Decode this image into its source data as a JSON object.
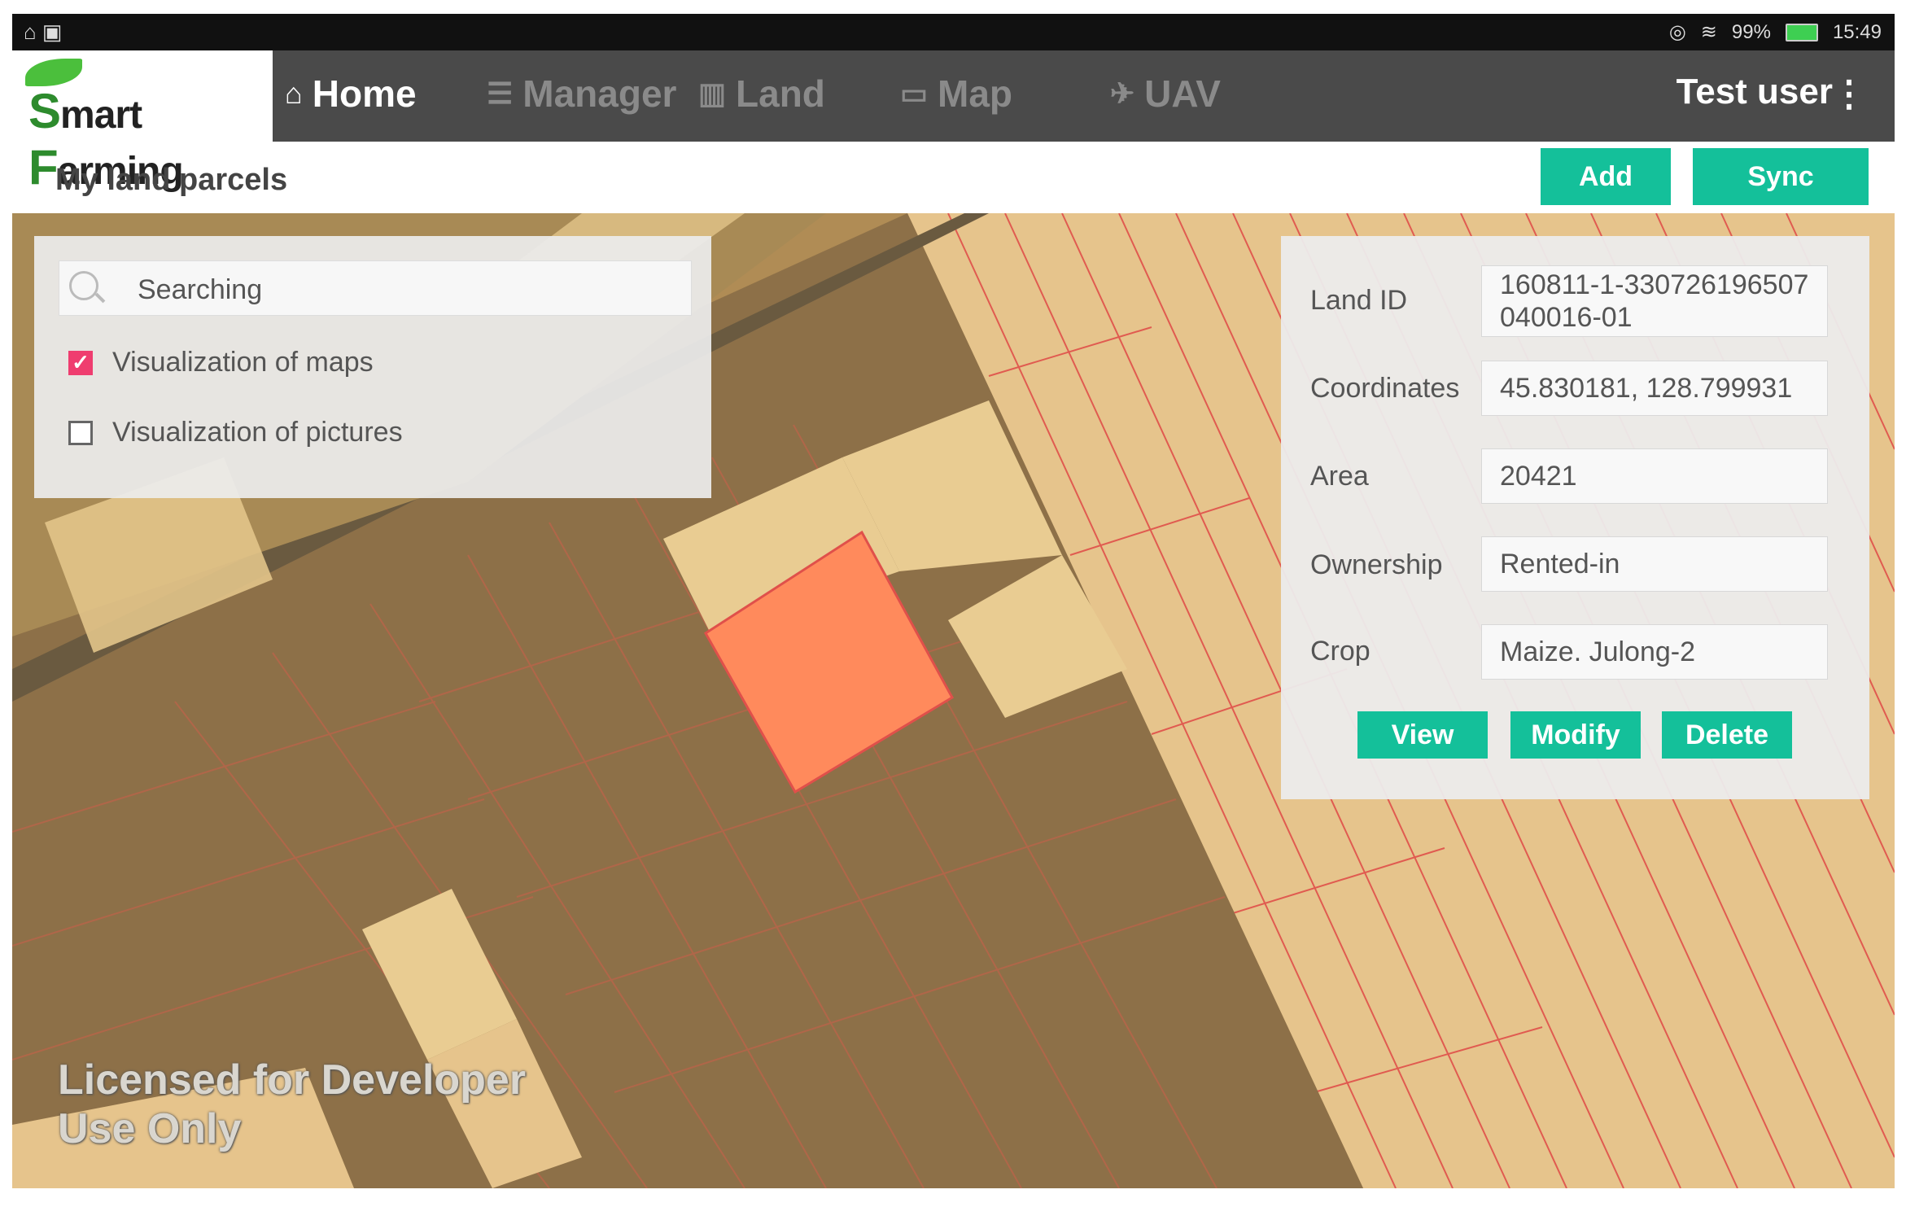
{
  "status_bar": {
    "battery": "99%",
    "time": "15:49"
  },
  "app": {
    "logo_text_prefix": "S",
    "logo_text": "mart",
    "logo_text_2_prefix": "F",
    "logo_text_2": "arming"
  },
  "nav": {
    "items": [
      {
        "label": "Home",
        "icon": "home-icon",
        "active": true
      },
      {
        "label": "Manager",
        "icon": "list-icon",
        "active": false
      },
      {
        "label": "Land",
        "icon": "land-icon",
        "active": false
      },
      {
        "label": "Map",
        "icon": "map-icon",
        "active": false
      },
      {
        "label": "UAV",
        "icon": "drone-icon",
        "active": false
      }
    ],
    "user": "Test user"
  },
  "page": {
    "title": "My land parcels",
    "add_label": "Add",
    "sync_label": "Sync"
  },
  "search": {
    "placeholder": "Searching",
    "options": [
      {
        "label": "Visualization of maps",
        "checked": true
      },
      {
        "label": "Visualization of pictures",
        "checked": false
      }
    ]
  },
  "parcel": {
    "land_id_label": "Land ID",
    "land_id": "160811-1-330726196507040016-01",
    "coordinates_label": "Coordinates",
    "coordinates": "45.830181, 128.799931",
    "area_label": "Area",
    "area": "20421",
    "ownership_label": "Ownership",
    "ownership": "Rented-in",
    "crop_label": "Crop",
    "crop": "Maize. Julong-2",
    "view_label": "View",
    "modify_label": "Modify",
    "delete_label": "Delete"
  },
  "map": {
    "watermark_line1": "Licensed for Developer",
    "watermark_line2": "Use Only",
    "colors": {
      "selected_parcel": "#ff8a5c",
      "parcel_outline": "#e0504a",
      "light_field": "#e9c98c",
      "dark_field": "#8a6e45"
    }
  }
}
